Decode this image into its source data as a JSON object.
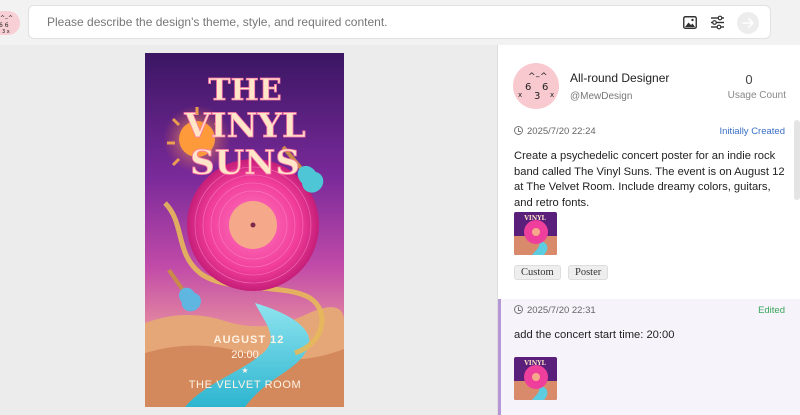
{
  "prompt": {
    "placeholder": "Please describe the design's theme, style, and required content."
  },
  "icons": {
    "image_upload": "image-icon",
    "settings": "sliders-icon",
    "send": "arrow-right-icon"
  },
  "poster": {
    "title_lines": [
      "THE",
      "VINYL",
      "SUNS"
    ],
    "date": "AUGUST 12",
    "time": "20:00",
    "star": "★",
    "venue": "THE VELVET ROOM"
  },
  "designer": {
    "name": "All-round Designer",
    "handle": "@MewDesign",
    "usage_count": "0",
    "usage_label": "Usage Count"
  },
  "history": [
    {
      "timestamp": "2025/7/20 22:24",
      "status": "Initially Created",
      "status_color": "#3a6fc4",
      "description": "Create a psychedelic concert poster for an indie rock band called The Vinyl Suns. The event is on August 12 at The Velvet Room. Include dreamy colors, guitars, and retro fonts.",
      "tags": [
        "Custom",
        "Poster"
      ]
    },
    {
      "timestamp": "2025/7/20 22:31",
      "status": "Edited",
      "status_color": "#3aa55a",
      "description": "add the concert start time: 20:00"
    }
  ]
}
